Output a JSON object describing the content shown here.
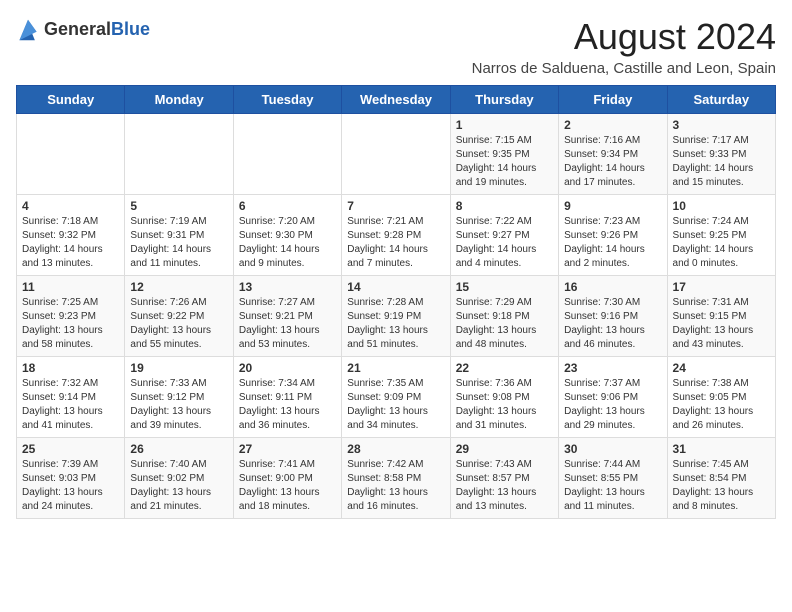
{
  "header": {
    "logo_general": "General",
    "logo_blue": "Blue",
    "month_year": "August 2024",
    "location": "Narros de Salduena, Castille and Leon, Spain"
  },
  "weekdays": [
    "Sunday",
    "Monday",
    "Tuesday",
    "Wednesday",
    "Thursday",
    "Friday",
    "Saturday"
  ],
  "weeks": [
    [
      {
        "day": "",
        "info": ""
      },
      {
        "day": "",
        "info": ""
      },
      {
        "day": "",
        "info": ""
      },
      {
        "day": "",
        "info": ""
      },
      {
        "day": "1",
        "info": "Sunrise: 7:15 AM\nSunset: 9:35 PM\nDaylight: 14 hours and 19 minutes."
      },
      {
        "day": "2",
        "info": "Sunrise: 7:16 AM\nSunset: 9:34 PM\nDaylight: 14 hours and 17 minutes."
      },
      {
        "day": "3",
        "info": "Sunrise: 7:17 AM\nSunset: 9:33 PM\nDaylight: 14 hours and 15 minutes."
      }
    ],
    [
      {
        "day": "4",
        "info": "Sunrise: 7:18 AM\nSunset: 9:32 PM\nDaylight: 14 hours and 13 minutes."
      },
      {
        "day": "5",
        "info": "Sunrise: 7:19 AM\nSunset: 9:31 PM\nDaylight: 14 hours and 11 minutes."
      },
      {
        "day": "6",
        "info": "Sunrise: 7:20 AM\nSunset: 9:30 PM\nDaylight: 14 hours and 9 minutes."
      },
      {
        "day": "7",
        "info": "Sunrise: 7:21 AM\nSunset: 9:28 PM\nDaylight: 14 hours and 7 minutes."
      },
      {
        "day": "8",
        "info": "Sunrise: 7:22 AM\nSunset: 9:27 PM\nDaylight: 14 hours and 4 minutes."
      },
      {
        "day": "9",
        "info": "Sunrise: 7:23 AM\nSunset: 9:26 PM\nDaylight: 14 hours and 2 minutes."
      },
      {
        "day": "10",
        "info": "Sunrise: 7:24 AM\nSunset: 9:25 PM\nDaylight: 14 hours and 0 minutes."
      }
    ],
    [
      {
        "day": "11",
        "info": "Sunrise: 7:25 AM\nSunset: 9:23 PM\nDaylight: 13 hours and 58 minutes."
      },
      {
        "day": "12",
        "info": "Sunrise: 7:26 AM\nSunset: 9:22 PM\nDaylight: 13 hours and 55 minutes."
      },
      {
        "day": "13",
        "info": "Sunrise: 7:27 AM\nSunset: 9:21 PM\nDaylight: 13 hours and 53 minutes."
      },
      {
        "day": "14",
        "info": "Sunrise: 7:28 AM\nSunset: 9:19 PM\nDaylight: 13 hours and 51 minutes."
      },
      {
        "day": "15",
        "info": "Sunrise: 7:29 AM\nSunset: 9:18 PM\nDaylight: 13 hours and 48 minutes."
      },
      {
        "day": "16",
        "info": "Sunrise: 7:30 AM\nSunset: 9:16 PM\nDaylight: 13 hours and 46 minutes."
      },
      {
        "day": "17",
        "info": "Sunrise: 7:31 AM\nSunset: 9:15 PM\nDaylight: 13 hours and 43 minutes."
      }
    ],
    [
      {
        "day": "18",
        "info": "Sunrise: 7:32 AM\nSunset: 9:14 PM\nDaylight: 13 hours and 41 minutes."
      },
      {
        "day": "19",
        "info": "Sunrise: 7:33 AM\nSunset: 9:12 PM\nDaylight: 13 hours and 39 minutes."
      },
      {
        "day": "20",
        "info": "Sunrise: 7:34 AM\nSunset: 9:11 PM\nDaylight: 13 hours and 36 minutes."
      },
      {
        "day": "21",
        "info": "Sunrise: 7:35 AM\nSunset: 9:09 PM\nDaylight: 13 hours and 34 minutes."
      },
      {
        "day": "22",
        "info": "Sunrise: 7:36 AM\nSunset: 9:08 PM\nDaylight: 13 hours and 31 minutes."
      },
      {
        "day": "23",
        "info": "Sunrise: 7:37 AM\nSunset: 9:06 PM\nDaylight: 13 hours and 29 minutes."
      },
      {
        "day": "24",
        "info": "Sunrise: 7:38 AM\nSunset: 9:05 PM\nDaylight: 13 hours and 26 minutes."
      }
    ],
    [
      {
        "day": "25",
        "info": "Sunrise: 7:39 AM\nSunset: 9:03 PM\nDaylight: 13 hours and 24 minutes."
      },
      {
        "day": "26",
        "info": "Sunrise: 7:40 AM\nSunset: 9:02 PM\nDaylight: 13 hours and 21 minutes."
      },
      {
        "day": "27",
        "info": "Sunrise: 7:41 AM\nSunset: 9:00 PM\nDaylight: 13 hours and 18 minutes."
      },
      {
        "day": "28",
        "info": "Sunrise: 7:42 AM\nSunset: 8:58 PM\nDaylight: 13 hours and 16 minutes."
      },
      {
        "day": "29",
        "info": "Sunrise: 7:43 AM\nSunset: 8:57 PM\nDaylight: 13 hours and 13 minutes."
      },
      {
        "day": "30",
        "info": "Sunrise: 7:44 AM\nSunset: 8:55 PM\nDaylight: 13 hours and 11 minutes."
      },
      {
        "day": "31",
        "info": "Sunrise: 7:45 AM\nSunset: 8:54 PM\nDaylight: 13 hours and 8 minutes."
      }
    ]
  ]
}
